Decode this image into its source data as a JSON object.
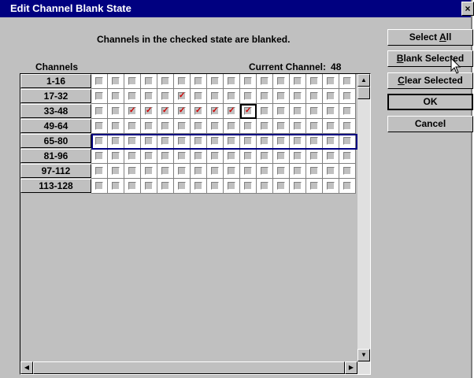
{
  "window": {
    "title": "Edit Channel Blank State",
    "close_glyph": "×"
  },
  "instructions": "Channels in the checked state are blanked.",
  "grid_header": {
    "channels_label": "Channels",
    "current_channel_label": "Current Channel:",
    "current_channel_value": "48"
  },
  "rows": [
    {
      "label": "1-16",
      "checked": []
    },
    {
      "label": "17-32",
      "checked": [
        5
      ]
    },
    {
      "label": "33-48",
      "checked": [
        2,
        3,
        4,
        5,
        6,
        7,
        8,
        9
      ]
    },
    {
      "label": "49-64",
      "checked": []
    },
    {
      "label": "65-80",
      "checked": []
    },
    {
      "label": "81-96",
      "checked": []
    },
    {
      "label": "97-112",
      "checked": []
    },
    {
      "label": "113-128",
      "checked": []
    }
  ],
  "current_cell": {
    "row": 2,
    "col": 9
  },
  "selected_row": 4,
  "buttons": {
    "select_all": {
      "label_pre": "Select ",
      "label_ul": "A",
      "label_post": "ll"
    },
    "blank_selected": {
      "label_pre": "",
      "label_ul": "B",
      "label_post": "lank Selected"
    },
    "clear_selected": {
      "label_pre": "",
      "label_ul": "C",
      "label_post": "lear Selected"
    },
    "ok": {
      "label": "OK"
    },
    "cancel": {
      "label": "Cancel"
    }
  },
  "check_glyph": "✓",
  "colors": {
    "titlebar": "#000080",
    "check": "#d00000",
    "selection": "#000080"
  }
}
